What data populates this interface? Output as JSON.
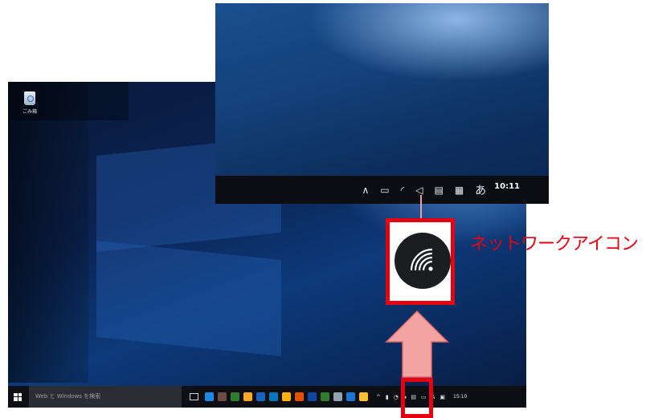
{
  "desktop": {
    "recycle_bin_label": "ごみ箱",
    "search_placeholder": "Web と Windows を検索",
    "tray_ime": "A",
    "clock": "15:10",
    "app_colors": [
      "#1e88e5",
      "#6d4c41",
      "#2e7d32",
      "#f9a825",
      "#1565c0",
      "#0277bd",
      "#ffb300",
      "#e65100",
      "#0d47a1",
      "#2e7d32",
      "#90a4ae",
      "#1976d2",
      "#fbc02d"
    ]
  },
  "zoomed": {
    "ime": "あ",
    "clock": "10:11"
  },
  "annotation": {
    "label": "ネットワークアイコン",
    "accent_color": "#e60012",
    "arrow_color": "#f4a3a3"
  },
  "icons": {
    "network": "wifi-icon",
    "chevron": "chevron-up-icon",
    "battery": "battery-icon",
    "volume": "volume-icon",
    "action_center": "action-center-icon",
    "keyboard": "keyboard-icon"
  }
}
